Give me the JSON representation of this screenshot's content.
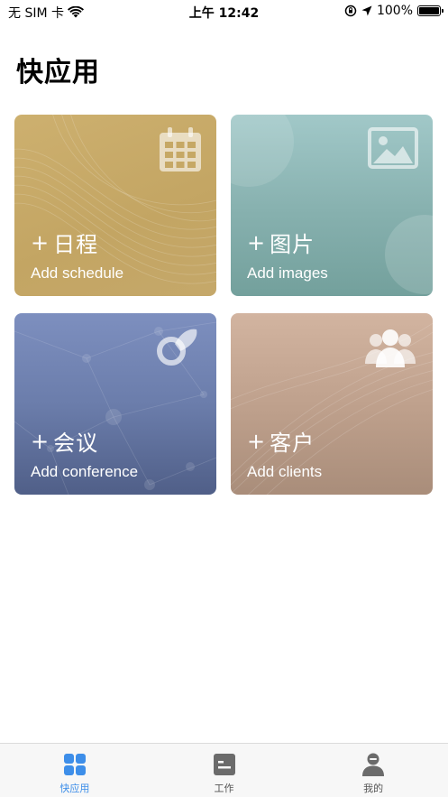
{
  "status_bar": {
    "carrier": "无 SIM 卡",
    "time": "上午 12:42",
    "battery": "100%"
  },
  "page": {
    "title": "快应用"
  },
  "cards": [
    {
      "plus": "+",
      "title": "日程",
      "subtitle": "Add schedule",
      "icon": "calendar-icon",
      "color": "#c8ab68"
    },
    {
      "plus": "+",
      "title": "图片",
      "subtitle": "Add images",
      "icon": "image-icon",
      "color": "#8ab4b2"
    },
    {
      "plus": "+",
      "title": "会议",
      "subtitle": "Add conference",
      "icon": "conference-icon",
      "color": "#6678a6"
    },
    {
      "plus": "+",
      "title": "客户",
      "subtitle": "Add clients",
      "icon": "clients-icon",
      "color": "#bf9f8a"
    }
  ],
  "tab_bar": {
    "active_color": "#3d8ee9",
    "tabs": [
      {
        "label": "快应用",
        "icon": "grid-icon",
        "active": true
      },
      {
        "label": "工作",
        "icon": "work-icon",
        "active": false
      },
      {
        "label": "我的",
        "icon": "profile-icon",
        "active": false
      }
    ]
  }
}
